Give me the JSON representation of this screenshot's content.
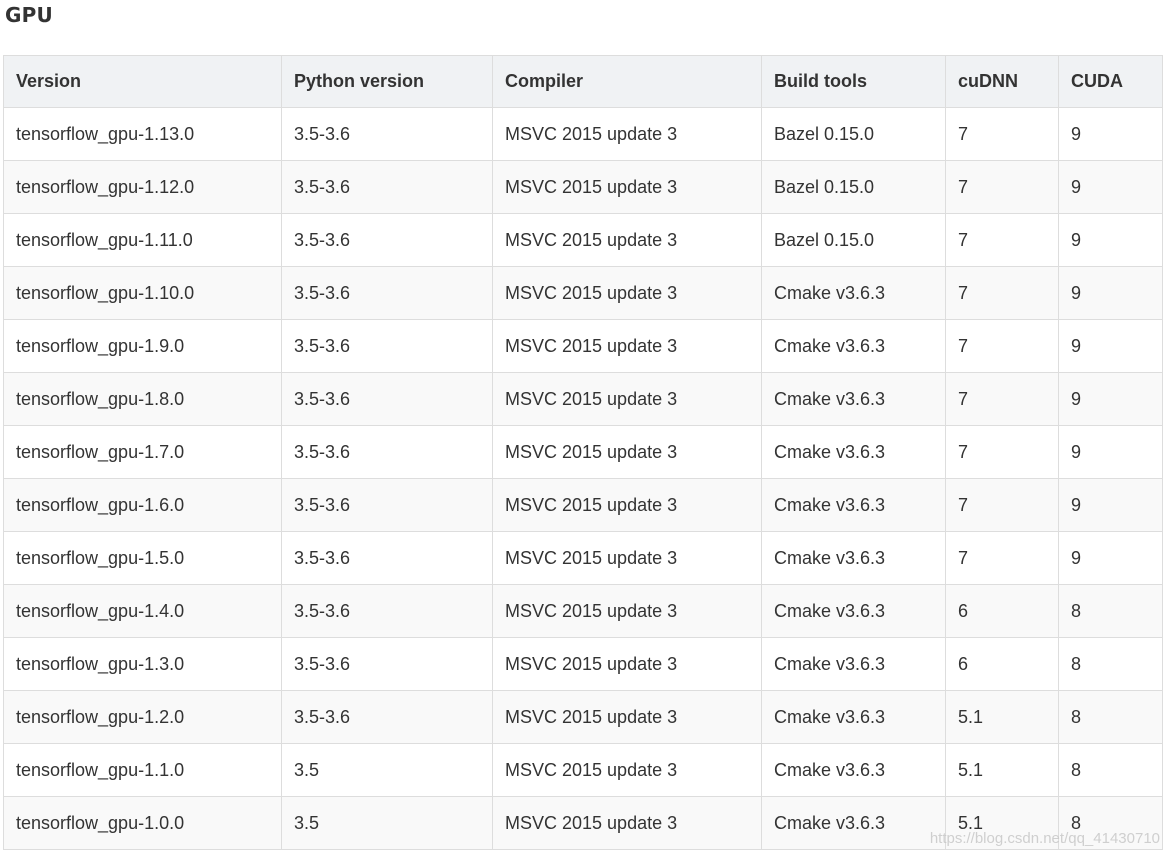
{
  "heading": "GPU",
  "table": {
    "headers": [
      "Version",
      "Python version",
      "Compiler",
      "Build tools",
      "cuDNN",
      "CUDA"
    ],
    "rows": [
      [
        "tensorflow_gpu-1.13.0",
        "3.5-3.6",
        "MSVC 2015 update 3",
        "Bazel 0.15.0",
        "7",
        "9"
      ],
      [
        "tensorflow_gpu-1.12.0",
        "3.5-3.6",
        "MSVC 2015 update 3",
        "Bazel 0.15.0",
        "7",
        "9"
      ],
      [
        "tensorflow_gpu-1.11.0",
        "3.5-3.6",
        "MSVC 2015 update 3",
        "Bazel 0.15.0",
        "7",
        "9"
      ],
      [
        "tensorflow_gpu-1.10.0",
        "3.5-3.6",
        "MSVC 2015 update 3",
        "Cmake v3.6.3",
        "7",
        "9"
      ],
      [
        "tensorflow_gpu-1.9.0",
        "3.5-3.6",
        "MSVC 2015 update 3",
        "Cmake v3.6.3",
        "7",
        "9"
      ],
      [
        "tensorflow_gpu-1.8.0",
        "3.5-3.6",
        "MSVC 2015 update 3",
        "Cmake v3.6.3",
        "7",
        "9"
      ],
      [
        "tensorflow_gpu-1.7.0",
        "3.5-3.6",
        "MSVC 2015 update 3",
        "Cmake v3.6.3",
        "7",
        "9"
      ],
      [
        "tensorflow_gpu-1.6.0",
        "3.5-3.6",
        "MSVC 2015 update 3",
        "Cmake v3.6.3",
        "7",
        "9"
      ],
      [
        "tensorflow_gpu-1.5.0",
        "3.5-3.6",
        "MSVC 2015 update 3",
        "Cmake v3.6.3",
        "7",
        "9"
      ],
      [
        "tensorflow_gpu-1.4.0",
        "3.5-3.6",
        "MSVC 2015 update 3",
        "Cmake v3.6.3",
        "6",
        "8"
      ],
      [
        "tensorflow_gpu-1.3.0",
        "3.5-3.6",
        "MSVC 2015 update 3",
        "Cmake v3.6.3",
        "6",
        "8"
      ],
      [
        "tensorflow_gpu-1.2.0",
        "3.5-3.6",
        "MSVC 2015 update 3",
        "Cmake v3.6.3",
        "5.1",
        "8"
      ],
      [
        "tensorflow_gpu-1.1.0",
        "3.5",
        "MSVC 2015 update 3",
        "Cmake v3.6.3",
        "5.1",
        "8"
      ],
      [
        "tensorflow_gpu-1.0.0",
        "3.5",
        "MSVC 2015 update 3",
        "Cmake v3.6.3",
        "5.1",
        "8"
      ]
    ]
  },
  "watermark": "https://blog.csdn.net/qq_41430710",
  "colors": {
    "header_bg": "#f0f2f4",
    "row_alt_bg": "#f9f9f9",
    "border": "#dddddd",
    "text": "#333333"
  }
}
